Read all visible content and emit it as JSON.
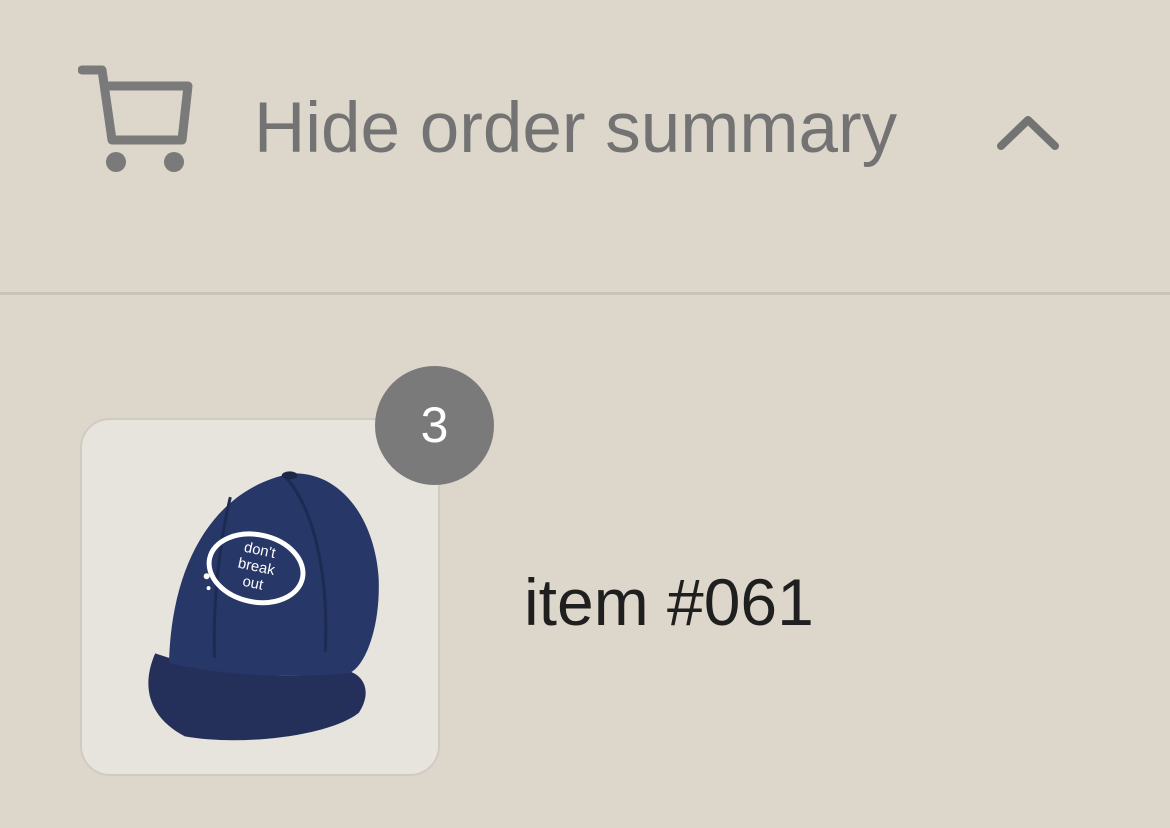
{
  "order_summary": {
    "toggle_label": "Hide order summary",
    "cart_icon": "cart-icon",
    "chevron_icon": "chevron-up-icon"
  },
  "line_items": [
    {
      "name": "item #061",
      "quantity": "3",
      "image": "navy-baseball-cap",
      "image_text": "don't break out"
    }
  ],
  "colors": {
    "background": "#ddd6ca",
    "muted_text": "#737373",
    "badge": "#7a7a7a",
    "item_text": "#1f1f1f",
    "cap": "#243562"
  }
}
